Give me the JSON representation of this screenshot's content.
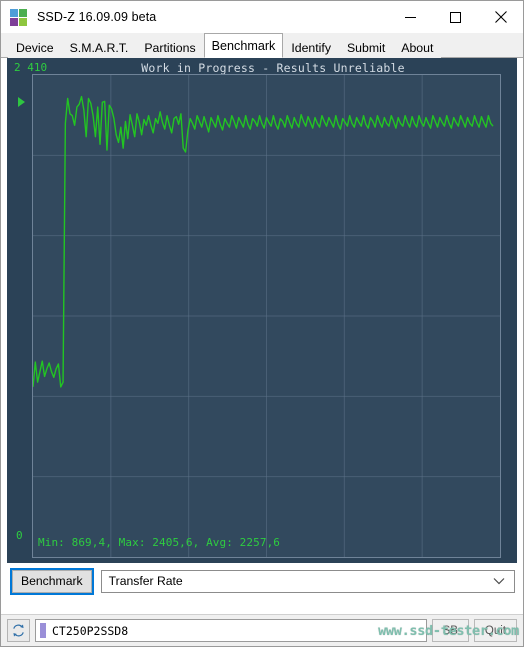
{
  "window": {
    "title": "SSD-Z 16.09.09 beta",
    "icon": "ssdz-logo-icon",
    "minimize_label": "—",
    "maximize_label": "□",
    "close_label": "×"
  },
  "tabs": [
    {
      "label": "Device",
      "active": false
    },
    {
      "label": "S.M.A.R.T.",
      "active": false
    },
    {
      "label": "Partitions",
      "active": false
    },
    {
      "label": "Benchmark",
      "active": true
    },
    {
      "label": "Identify",
      "active": false
    },
    {
      "label": "Submit",
      "active": false
    },
    {
      "label": "About",
      "active": false
    }
  ],
  "chart": {
    "title": "Work in Progress - Results Unreliable",
    "y_max_label": "2 410",
    "y_min_label": "0",
    "stats": "Min: 869,4, Max: 2405,6, Avg: 2257,6",
    "min": "869,4",
    "max": "2405,6",
    "avg": "2257,6",
    "line_color": "#22c522",
    "background_color": "#32495e",
    "panel_color": "#2b4257",
    "grid_color": "#5d7289",
    "text_color": "#2ecc40",
    "title_color": "#d4dce4",
    "marker": "play-triangle-marker"
  },
  "chart_data": {
    "type": "line",
    "title": "Work in Progress - Results Unreliable",
    "xlabel": "",
    "ylabel": "",
    "ylim": [
      0,
      2410
    ],
    "grid": true,
    "legend": null,
    "series": [
      {
        "name": "Transfer Rate",
        "values": [
          880,
          1010,
          905,
          960,
          1015,
          935,
          975,
          1005,
          960,
          930,
          975,
          1000,
          880,
          905,
          2260,
          2390,
          2310,
          2300,
          2250,
          2345,
          2360,
          2400,
          2330,
          2190,
          2390,
          2365,
          2300,
          2190,
          2345,
          2150,
          2370,
          2375,
          2120,
          2355,
          2335,
          2285,
          2200,
          2160,
          2240,
          2130,
          2270,
          2180,
          2305,
          2250,
          2190,
          2310,
          2265,
          2200,
          2280,
          2250,
          2300,
          2250,
          2210,
          2285,
          2260,
          2320,
          2265,
          2230,
          2300,
          2250,
          2210,
          2285,
          2295,
          2255,
          2310,
          2130,
          2110,
          2220,
          2285,
          2260,
          2230,
          2300,
          2270,
          2240,
          2295,
          2255,
          2215,
          2290,
          2265,
          2240,
          2300,
          2255,
          2225,
          2285,
          2260,
          2240,
          2300,
          2270,
          2235,
          2290,
          2265,
          2240,
          2300,
          2255,
          2230,
          2285,
          2270,
          2245,
          2300,
          2260,
          2235,
          2290,
          2265,
          2245,
          2300,
          2255,
          2230,
          2285,
          2270,
          2240,
          2300,
          2265,
          2235,
          2290,
          2260,
          2240,
          2305,
          2270,
          2245,
          2295,
          2265,
          2235,
          2290,
          2260,
          2240,
          2300,
          2270,
          2245,
          2290,
          2265,
          2240,
          2300,
          2255,
          2230,
          2285,
          2265,
          2245,
          2300,
          2260,
          2240,
          2290,
          2265,
          2245,
          2300,
          2255,
          2235,
          2290,
          2270,
          2240,
          2300,
          2265,
          2240,
          2290,
          2260,
          2245,
          2300,
          2270,
          2235,
          2290,
          2260,
          2245,
          2300,
          2265,
          2240,
          2295,
          2260,
          2240,
          2300,
          2265,
          2245,
          2290,
          2260,
          2235,
          2300,
          2270,
          2240,
          2290,
          2265,
          2245,
          2300,
          2260,
          2235,
          2290,
          2265,
          2245,
          2300,
          2270,
          2240,
          2290,
          2260,
          2245,
          2300,
          2265,
          2240,
          2295,
          2265,
          2240,
          2300,
          2260,
          2245
        ]
      }
    ]
  },
  "controls": {
    "benchmark_button": "Benchmark",
    "mode_select": "Transfer Rate",
    "mode_options": [
      "Transfer Rate"
    ],
    "chevron": "chevron-down-icon"
  },
  "statusbar": {
    "refresh_icon": "refresh-icon",
    "drive_value": "CT250P2SSD8",
    "buttons": [
      "SB",
      "Quit"
    ],
    "watermark": "www.ssd-tester.com"
  }
}
